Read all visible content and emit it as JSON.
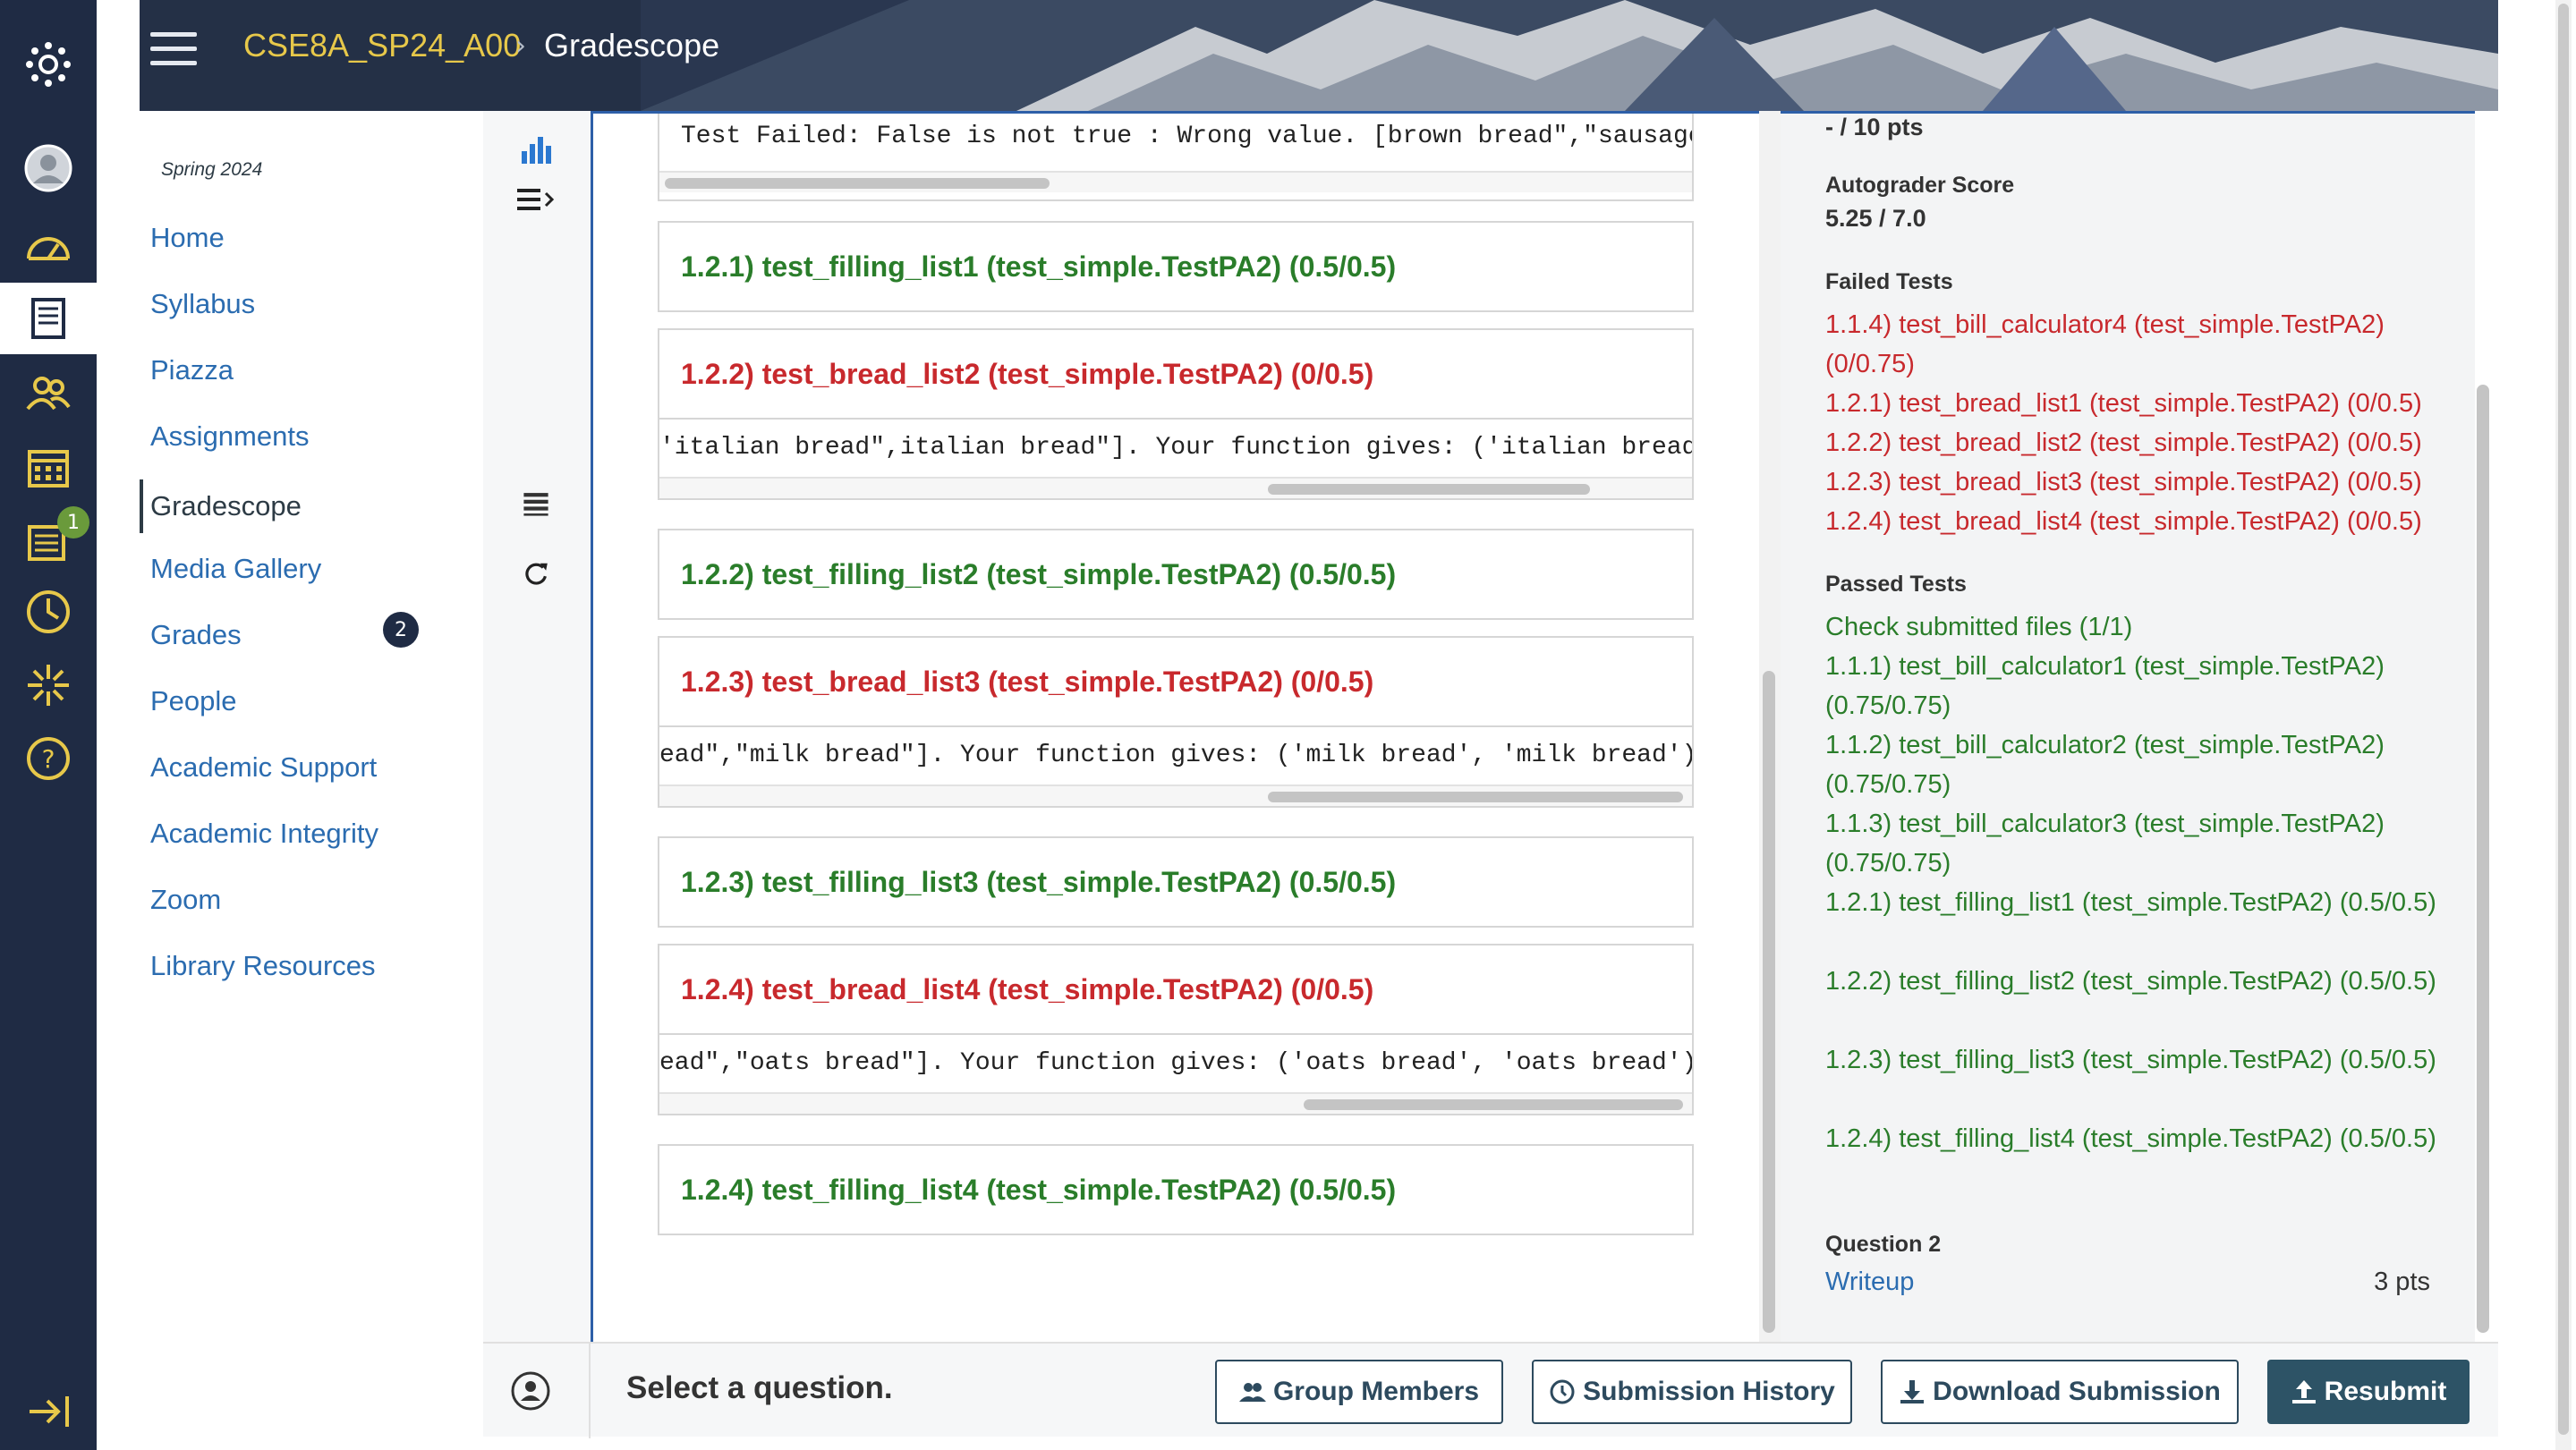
{
  "header": {
    "course": "CSE8A_SP24_A00",
    "separator": "›",
    "page": "Gradescope"
  },
  "course_nav": {
    "term": "Spring 2024",
    "items": [
      {
        "label": "Home"
      },
      {
        "label": "Syllabus"
      },
      {
        "label": "Piazza"
      },
      {
        "label": "Assignments"
      },
      {
        "label": "Gradescope"
      },
      {
        "label": "Media Gallery"
      },
      {
        "label": "Grades",
        "badge": "2"
      },
      {
        "label": "People"
      },
      {
        "label": "Academic Support"
      },
      {
        "label": "Academic Integrity"
      },
      {
        "label": "Zoom"
      },
      {
        "label": "Library Resources"
      }
    ]
  },
  "global_nav": {
    "inbox_badge": "1",
    "icons": [
      "logo-icon",
      "account-icon",
      "dashboard-icon",
      "courses-icon",
      "groups-icon",
      "calendar-icon",
      "inbox-icon",
      "history-icon",
      "studio-icon",
      "help-icon",
      "collapse-icon"
    ]
  },
  "tests_panel": {
    "top_output": "Test Failed: False is not true : Wrong value. [brown bread\",\"sausage",
    "results": [
      {
        "title": "1.2.1) test_filling_list1 (test_simple.TestPA2) (0.5/0.5)",
        "status": "pass"
      },
      {
        "title": "1.2.2) test_bread_list2 (test_simple.TestPA2) (0/0.5)",
        "status": "fail",
        "output": "'italian bread\",italian bread\"]. Your function gives: ('italian bread"
      },
      {
        "title": "1.2.2) test_filling_list2 (test_simple.TestPA2) (0.5/0.5)",
        "status": "pass"
      },
      {
        "title": "1.2.3) test_bread_list3 (test_simple.TestPA2) (0/0.5)",
        "status": "fail",
        "output": "ead\",\"milk bread\"]. Your function gives: ('milk bread', 'milk bread')"
      },
      {
        "title": "1.2.3) test_filling_list3 (test_simple.TestPA2) (0.5/0.5)",
        "status": "pass"
      },
      {
        "title": "1.2.4) test_bread_list4 (test_simple.TestPA2) (0/0.5)",
        "status": "fail",
        "output": "ead\",\"oats bread\"]. Your function gives: ('oats bread', 'oats bread')"
      },
      {
        "title": "1.2.4) test_filling_list4 (test_simple.TestPA2) (0.5/0.5)",
        "status": "pass"
      }
    ]
  },
  "sidebar": {
    "total": "- / 10 pts",
    "autograder_label": "Autograder Score",
    "autograder_value": "5.25 / 7.0",
    "failed_label": "Failed Tests",
    "failed": [
      "1.1.4) test_bill_calculator4 (test_simple.TestPA2) (0/0.75)",
      "1.2.1) test_bread_list1 (test_simple.TestPA2) (0/0.5)",
      "1.2.2) test_bread_list2 (test_simple.TestPA2) (0/0.5)",
      "1.2.3) test_bread_list3 (test_simple.TestPA2) (0/0.5)",
      "1.2.4) test_bread_list4 (test_simple.TestPA2) (0/0.5)"
    ],
    "passed_label": "Passed Tests",
    "passed": [
      "Check submitted files (1/1)",
      "1.1.1) test_bill_calculator1 (test_simple.TestPA2) (0.75/0.75)",
      "1.1.2) test_bill_calculator2 (test_simple.TestPA2) (0.75/0.75)",
      "1.1.3) test_bill_calculator3 (test_simple.TestPA2) (0.75/0.75)",
      "1.2.1) test_filling_list1 (test_simple.TestPA2) (0.5/0.5)",
      "1.2.2) test_filling_list2 (test_simple.TestPA2) (0.5/0.5)",
      "1.2.3) test_filling_list3 (test_simple.TestPA2) (0.5/0.5)",
      "1.2.4) test_filling_list4 (test_simple.TestPA2) (0.5/0.5)"
    ],
    "question2_label": "Question 2",
    "question2_link": "Writeup",
    "question2_pts": "3 pts"
  },
  "bottom_bar": {
    "prompt": "Select a question.",
    "group_members": "Group Members",
    "submission_history": "Submission History",
    "download_submission": "Download Submission",
    "resubmit": "Resubmit"
  },
  "colors": {
    "nav_bg": "#1f2b44",
    "accent_yellow": "#e7c84a",
    "pass_green": "#2a7d2a",
    "fail_red": "#c8292d",
    "link_blue": "#2b6cb0",
    "primary_button": "#2d5366"
  }
}
